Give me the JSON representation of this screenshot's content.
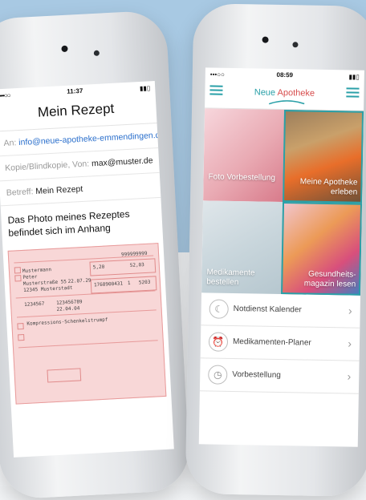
{
  "left_phone": {
    "status": {
      "dots": "•••○○",
      "time": "11:37",
      "battery": "▮▮▯"
    },
    "title": "Mein Rezept",
    "to_label": "An:",
    "to_value": "info@neue-apotheke-emmendingen.de",
    "cc_label": "Kopie/Blindkopie, Von:",
    "cc_value": "max@muster.de",
    "subject_label": "Betreff:",
    "subject_value": "Mein Rezept",
    "body": "Das Photo meines Rezeptes befindet sich im Anhang",
    "prescription": {
      "name1": "Mustermann",
      "name2": "Peter",
      "street": "Musterstraße 55",
      "city": "12345 Musterstadt",
      "birth": "22.07.29",
      "id1": "1234567",
      "id2": "123456789",
      "date": "22.04.04",
      "drug": "Kompressions-Schenkelstrumpf",
      "value1": "5,20",
      "value2": "52,03",
      "code": "999999999",
      "pzn": "1768900431",
      "qty": "1",
      "qty2": "5203"
    }
  },
  "right_phone": {
    "status": {
      "dots": "•••○○",
      "time": "08:59",
      "battery": "▮▮▯"
    },
    "logo_part1": "Neue ",
    "logo_part2": "Apotheke",
    "tiles": [
      {
        "label": "Foto Vorbestellung"
      },
      {
        "label": "Meine Apotheke erleben"
      },
      {
        "label": "Medikamente bestellen"
      },
      {
        "label": "Gesundheits- magazin lesen"
      }
    ],
    "menu": [
      {
        "label": "Notdienst Kalender",
        "icon": "moon-icon",
        "glyph": "☾"
      },
      {
        "label": "Medikamenten-Planer",
        "icon": "alarm-clock-icon",
        "glyph": "⏰"
      },
      {
        "label": "Vorbestellung",
        "icon": "clock-icon",
        "glyph": "◷"
      }
    ],
    "chevron": "›"
  },
  "colors": {
    "teal": "#2aa0a8",
    "brand_red": "#d64b4b",
    "link_blue": "#2a6fcc"
  }
}
